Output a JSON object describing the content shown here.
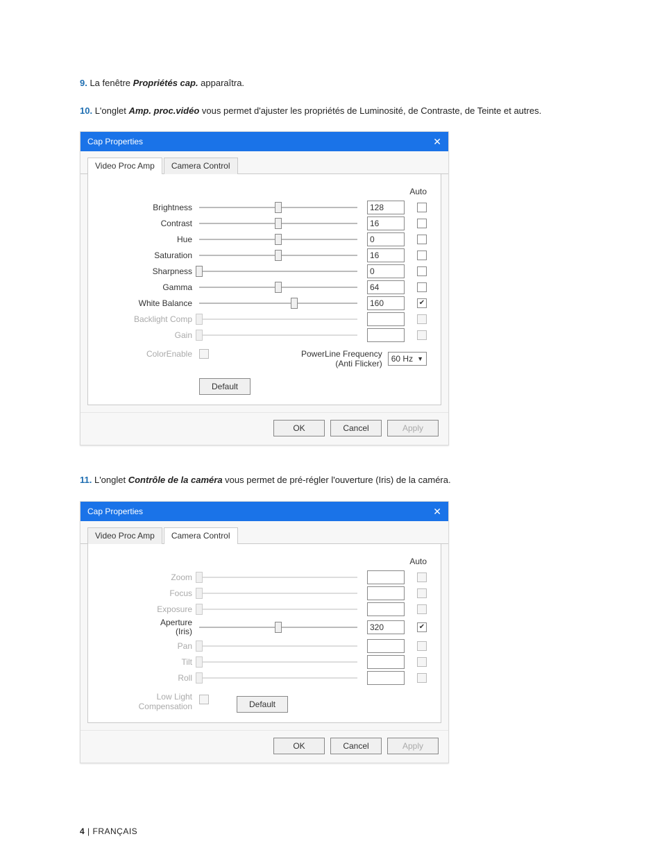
{
  "steps": {
    "s9": {
      "num": "9.",
      "before": " La fenêtre ",
      "bold": "Propriétés cap.",
      "after": " apparaîtra."
    },
    "s10": {
      "num": "10.",
      "before": " L'onglet ",
      "bold": "Amp. proc.vidéo",
      "after": " vous permet d'ajuster les propriétés de Luminosité, de Contraste, de Teinte et autres."
    },
    "s11": {
      "num": "11.",
      "before": " L'onglet ",
      "bold": "Contrôle de la caméra",
      "after": " vous permet de pré-régler l'ouverture (Iris) de la caméra."
    }
  },
  "dialog1": {
    "title": "Cap Properties",
    "tabs": {
      "videoProcAmp": "Video Proc Amp",
      "cameraControl": "Camera Control"
    },
    "autoHeader": "Auto",
    "rows": [
      {
        "label": "Brightness",
        "value": "128",
        "pos": 50,
        "auto": false,
        "enabled": true
      },
      {
        "label": "Contrast",
        "value": "16",
        "pos": 50,
        "auto": false,
        "enabled": true
      },
      {
        "label": "Hue",
        "value": "0",
        "pos": 50,
        "auto": false,
        "enabled": true
      },
      {
        "label": "Saturation",
        "value": "16",
        "pos": 50,
        "auto": false,
        "enabled": true
      },
      {
        "label": "Sharpness",
        "value": "0",
        "pos": 0,
        "auto": false,
        "enabled": true
      },
      {
        "label": "Gamma",
        "value": "64",
        "pos": 50,
        "auto": false,
        "enabled": true
      },
      {
        "label": "White Balance",
        "value": "160",
        "pos": 60,
        "auto": true,
        "enabled": true
      },
      {
        "label": "Backlight Comp",
        "value": "",
        "pos": 0,
        "auto": false,
        "enabled": false
      },
      {
        "label": "Gain",
        "value": "",
        "pos": 0,
        "auto": false,
        "enabled": false
      }
    ],
    "colorEnable": {
      "label": "ColorEnable",
      "checked": false
    },
    "powerline": {
      "label1": "PowerLine Frequency",
      "label2": "(Anti Flicker)",
      "value": "60 Hz"
    },
    "defaultBtn": "Default",
    "buttons": {
      "ok": "OK",
      "cancel": "Cancel",
      "apply": "Apply"
    }
  },
  "dialog2": {
    "title": "Cap Properties",
    "tabs": {
      "videoProcAmp": "Video Proc Amp",
      "cameraControl": "Camera Control"
    },
    "autoHeader": "Auto",
    "rows": [
      {
        "label": "Zoom",
        "value": "",
        "pos": 0,
        "auto": false,
        "enabled": false
      },
      {
        "label": "Focus",
        "value": "",
        "pos": 0,
        "auto": false,
        "enabled": false
      },
      {
        "label": "Exposure",
        "value": "",
        "pos": 0,
        "auto": false,
        "enabled": false
      },
      {
        "label": "Aperture (Iris)",
        "value": "320",
        "pos": 50,
        "auto": true,
        "enabled": true,
        "twoLine": true,
        "label1": "Aperture",
        "label2": "(Iris)"
      },
      {
        "label": "Pan",
        "value": "",
        "pos": 0,
        "auto": false,
        "enabled": false
      },
      {
        "label": "Tilt",
        "value": "",
        "pos": 0,
        "auto": false,
        "enabled": false
      },
      {
        "label": "Roll",
        "value": "",
        "pos": 0,
        "auto": false,
        "enabled": false
      }
    ],
    "lowlight": {
      "label1": "Low Light",
      "label2": "Compensation",
      "checked": false
    },
    "defaultBtn": "Default",
    "buttons": {
      "ok": "OK",
      "cancel": "Cancel",
      "apply": "Apply"
    }
  },
  "footer": {
    "page": "4",
    "sep": " | ",
    "lang": "FRANÇAIS"
  }
}
